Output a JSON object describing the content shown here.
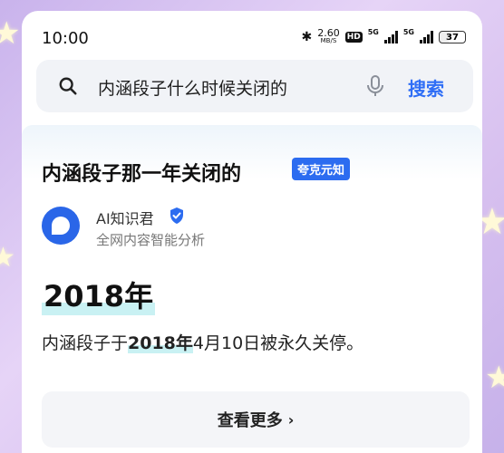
{
  "status_bar": {
    "time": "10:00",
    "speed_value": "2.60",
    "speed_unit": "MB/S",
    "hd_label": "HD",
    "net1": "5G",
    "net2": "5G",
    "battery": "37",
    "battery_level": 0.37
  },
  "search": {
    "query": "内涵段子什么时候关闭的",
    "button_label": "搜索"
  },
  "result": {
    "title": "内涵段子那一年关闭的",
    "badge": "夸克元知",
    "author": "AI知识君",
    "author_sub": "全网内容智能分析",
    "answer": "2018年",
    "detail_prefix": "内涵段子于",
    "detail_highlight": "2018年",
    "detail_suffix": "4月10日被永久关停。",
    "more_label": "查看更多"
  },
  "colors": {
    "accent": "#2f6ef6",
    "badge": "#2c6cf0",
    "highlight": "#c9f1f3"
  }
}
